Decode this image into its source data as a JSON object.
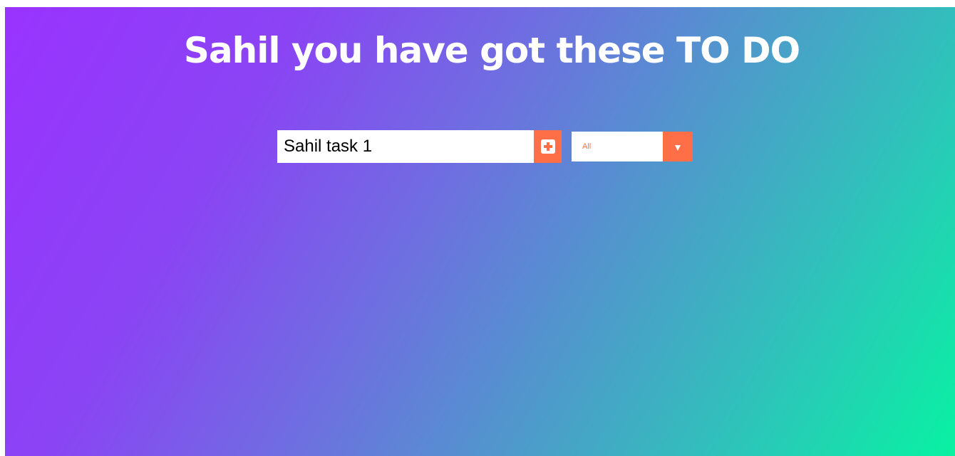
{
  "header": {
    "title": "Sahil you have got these TO DO"
  },
  "form": {
    "input_value": "Sahil task 1",
    "add_icon": "plus-square-icon",
    "filter": {
      "selected": "All",
      "options": [
        "All"
      ],
      "arrow_icon": "caret-down-icon"
    }
  },
  "todos": [],
  "colors": {
    "accent": "#ff6f47",
    "gradient_start": "#9933ff",
    "gradient_end": "#08f2a2",
    "title_text": "#ffffff"
  }
}
